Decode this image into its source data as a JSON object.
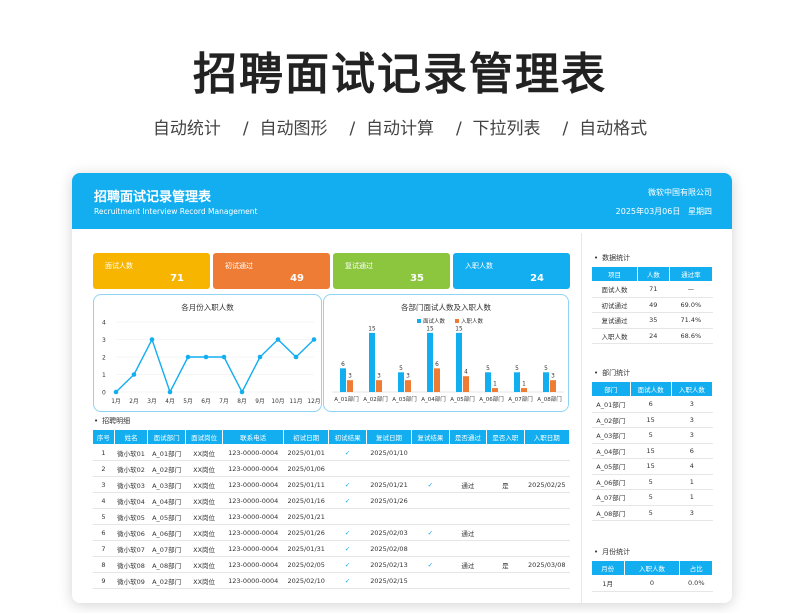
{
  "page": {
    "title": "招聘面试记录管理表",
    "features": [
      "自动统计",
      "/  自动图形",
      "/  自动计算",
      "/  下拉列表",
      "/  自动格式"
    ]
  },
  "header": {
    "title": "招聘面试记录管理表",
    "subtitle": "Recruitment Interview Record Management",
    "company": "微软中国有限公司",
    "date": "2025年03月06日",
    "weekday": "星期四"
  },
  "kpis": [
    {
      "label": "面试人数",
      "value": "71",
      "color": "#f7b500"
    },
    {
      "label": "初试通过",
      "value": "49",
      "color": "#ef7c34"
    },
    {
      "label": "复试通过",
      "value": "35",
      "color": "#8cc63f"
    },
    {
      "label": "入职人数",
      "value": "24",
      "color": "#12aef0"
    }
  ],
  "chart_data": [
    {
      "type": "line",
      "title": "各月份入职人数",
      "categories": [
        "1月",
        "2月",
        "3月",
        "4月",
        "5月",
        "6月",
        "7月",
        "8月",
        "9月",
        "10月",
        "11月",
        "12月"
      ],
      "values": [
        0,
        1,
        3,
        0,
        2,
        2,
        2,
        0,
        2,
        3,
        2,
        3
      ],
      "ylim": [
        0,
        4
      ],
      "yticks": [
        "0",
        "1",
        "2",
        "3",
        "4"
      ],
      "color": "#12aef0"
    },
    {
      "type": "bar",
      "title": "各部门面试人数及入职人数",
      "categories": [
        "A_01部门",
        "A_02部门",
        "A_03部门",
        "A_04部门",
        "A_05部门",
        "A_06部门",
        "A_07部门",
        "A_08部门"
      ],
      "series": [
        {
          "name": "面试人数",
          "values": [
            6,
            15,
            5,
            15,
            15,
            5,
            5,
            5
          ],
          "color": "#12aef0"
        },
        {
          "name": "入职人数",
          "values": [
            3,
            3,
            3,
            6,
            4,
            1,
            1,
            3
          ],
          "color": "#ef7c34"
        }
      ],
      "ylim": [
        0,
        17
      ]
    }
  ],
  "records": {
    "section_label": "招聘明细",
    "columns": [
      "序号",
      "姓名",
      "面试部门",
      "面试岗位",
      "联系电话",
      "初试日期",
      "初试结果",
      "复试日期",
      "复试结果",
      "是否通过",
      "是否入职",
      "入职日期"
    ],
    "rows": [
      [
        "1",
        "微小软01",
        "A_01部门",
        "XX岗位",
        "123-0000-0004",
        "2025/01/01",
        "✓",
        "2025/01/10",
        "",
        "",
        "",
        ""
      ],
      [
        "2",
        "微小软02",
        "A_02部门",
        "XX岗位",
        "123-0000-0004",
        "2025/01/06",
        "",
        "",
        "",
        "",
        "",
        ""
      ],
      [
        "3",
        "微小软03",
        "A_03部门",
        "XX岗位",
        "123-0000-0004",
        "2025/01/11",
        "✓",
        "2025/01/21",
        "✓",
        "通过",
        "是",
        "2025/02/25"
      ],
      [
        "4",
        "微小软04",
        "A_04部门",
        "XX岗位",
        "123-0000-0004",
        "2025/01/16",
        "✓",
        "2025/01/26",
        "",
        "",
        "",
        ""
      ],
      [
        "5",
        "微小软05",
        "A_05部门",
        "XX岗位",
        "123-0000-0004",
        "2025/01/21",
        "",
        "",
        "",
        "",
        "",
        ""
      ],
      [
        "6",
        "微小软06",
        "A_06部门",
        "XX岗位",
        "123-0000-0004",
        "2025/01/26",
        "✓",
        "2025/02/03",
        "✓",
        "通过",
        "",
        ""
      ],
      [
        "7",
        "微小软07",
        "A_07部门",
        "XX岗位",
        "123-0000-0004",
        "2025/01/31",
        "✓",
        "2025/02/08",
        "",
        "",
        "",
        ""
      ],
      [
        "8",
        "微小软08",
        "A_08部门",
        "XX岗位",
        "123-0000-0004",
        "2025/02/05",
        "✓",
        "2025/02/13",
        "✓",
        "通过",
        "是",
        "2025/03/08"
      ],
      [
        "9",
        "微小软09",
        "A_02部门",
        "XX岗位",
        "123-0000-0004",
        "2025/02/10",
        "✓",
        "2025/02/15",
        "",
        "",
        "",
        ""
      ]
    ]
  },
  "data_stats": {
    "section_label": "数据统计",
    "columns": [
      "项目",
      "人数",
      "通过率"
    ],
    "rows": [
      [
        "面试人数",
        "71",
        "—"
      ],
      [
        "初试通过",
        "49",
        "69.0%"
      ],
      [
        "复试通过",
        "35",
        "71.4%"
      ],
      [
        "入职人数",
        "24",
        "68.6%"
      ]
    ]
  },
  "dept_stats": {
    "section_label": "部门统计",
    "columns": [
      "部门",
      "面试人数",
      "入职人数"
    ],
    "rows": [
      [
        "A_01部门",
        "6",
        "3"
      ],
      [
        "A_02部门",
        "15",
        "3"
      ],
      [
        "A_03部门",
        "5",
        "3"
      ],
      [
        "A_04部门",
        "15",
        "6"
      ],
      [
        "A_05部门",
        "15",
        "4"
      ],
      [
        "A_06部门",
        "5",
        "1"
      ],
      [
        "A_07部门",
        "5",
        "1"
      ],
      [
        "A_08部门",
        "5",
        "3"
      ]
    ]
  },
  "month_stats": {
    "section_label": "月份统计",
    "columns": [
      "月份",
      "入职人数",
      "占比"
    ],
    "rows": [
      [
        "1月",
        "0",
        "0.0%"
      ]
    ]
  }
}
